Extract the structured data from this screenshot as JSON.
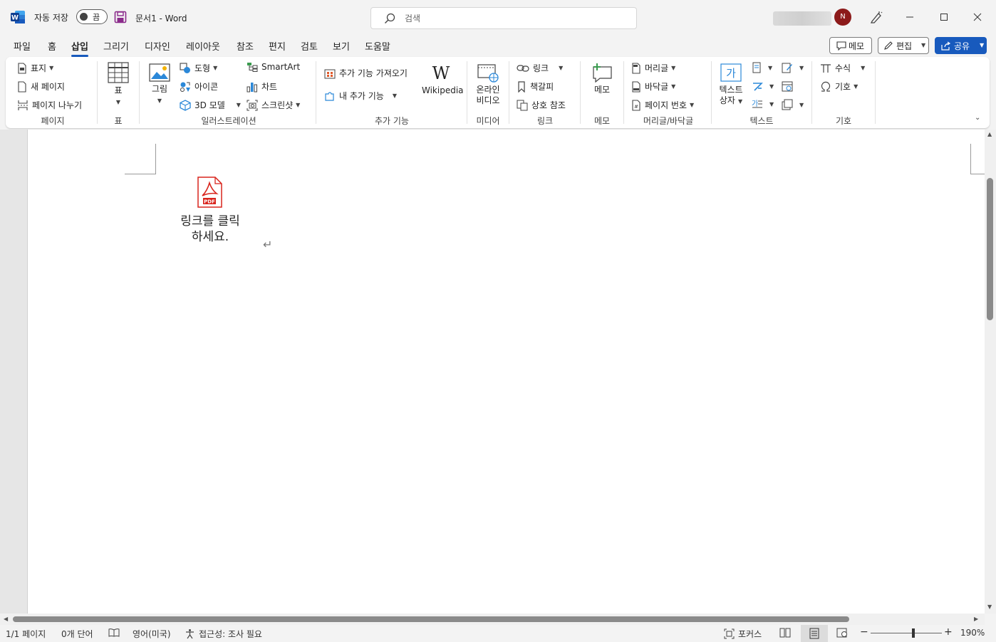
{
  "titlebar": {
    "autosave_label": "자동 저장",
    "autosave_state": "끔",
    "doc_name": "문서1  -  Word",
    "search_placeholder": "검색",
    "avatar_initial": "N"
  },
  "tabs": [
    "파일",
    "홈",
    "삽입",
    "그리기",
    "디자인",
    "레이아웃",
    "참조",
    "편지",
    "검토",
    "보기",
    "도움말"
  ],
  "active_tab": "삽입",
  "actions": {
    "comment": "메모",
    "edit": "편집",
    "share": "공유"
  },
  "ribbon": {
    "pages": {
      "cover": "표지",
      "blank": "새 페이지",
      "break": "페이지 나누기",
      "label": "페이지"
    },
    "table": {
      "table": "표",
      "label": "표"
    },
    "illustrations": {
      "pictures": "그림",
      "shapes": "도형",
      "icons": "아이콘",
      "models3d": "3D 모델",
      "smartart": "SmartArt",
      "chart": "차트",
      "screenshot": "스크린샷",
      "label": "일러스트레이션"
    },
    "addins": {
      "get": "추가 기능 가져오기",
      "my": "내 추가 기능",
      "wikipedia": "Wikipedia",
      "label": "추가 기능"
    },
    "media": {
      "online_video_1": "온라인",
      "online_video_2": "비디오",
      "label": "미디어"
    },
    "links": {
      "link": "링크",
      "bookmark": "책갈피",
      "crossref": "상호 참조",
      "label": "링크"
    },
    "comments": {
      "comment": "메모",
      "label": "메모"
    },
    "header_footer": {
      "header": "머리글",
      "footer": "바닥글",
      "page_number": "페이지 번호",
      "label": "머리글/바닥글"
    },
    "text": {
      "textbox_1": "텍스트",
      "textbox_2": "상자",
      "label": "텍스트"
    },
    "symbols": {
      "equation": "수식",
      "symbol": "기호",
      "label": "기호"
    }
  },
  "document": {
    "pdf_badge": "PDF",
    "caption_line1": "링크를 클릭",
    "caption_line2": "하세요.",
    "para_mark": "↵"
  },
  "status": {
    "page": "1/1 페이지",
    "words": "0개 단어",
    "language": "영어(미국)",
    "accessibility": "접근성: 조사 필요",
    "focus": "포커스",
    "zoom": "190%"
  },
  "colors": {
    "accent": "#185abd",
    "avatar": "#8c1a1a",
    "pdf_red": "#d9251d"
  }
}
